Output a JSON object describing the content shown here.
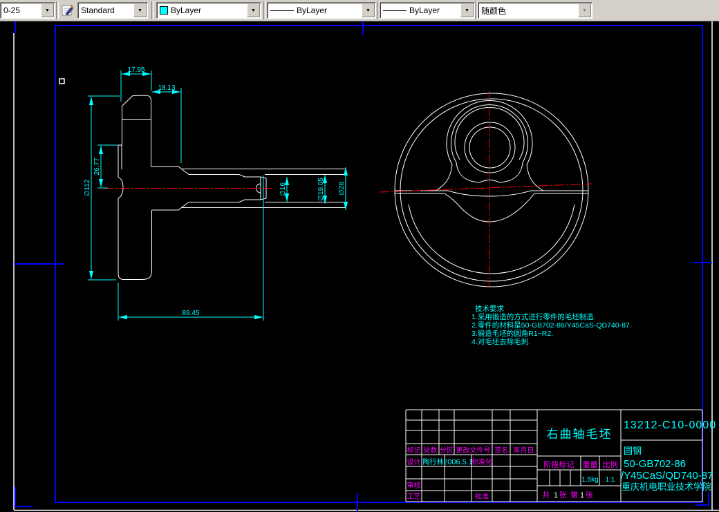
{
  "toolbar": {
    "dim_style_value": "0-25",
    "text_style_value": "Standard",
    "color_value": "ByLayer",
    "linetype_value": "ByLayer",
    "lineweight_value": "ByLayer",
    "plot_style_value": "随颜色",
    "dropdown_glyph": "▼"
  },
  "colors": {
    "cad_cyan": "#00ffff",
    "cad_red": "#ff0000",
    "cad_magenta": "#ff00ff",
    "cad_white": "#ffffff",
    "frame_blue": "#0000ff"
  },
  "dimensions": {
    "d_17_95": "17.95",
    "d_18_13": "18.13",
    "d_26_77": "26.77",
    "d_dia112": "∅112",
    "d_89_45": "89.45",
    "d_dia16": "∅16",
    "d_dia19_05": "∅19.05",
    "d_dia28": "∅28"
  },
  "tech_requirements": {
    "title": "技术要求",
    "line1": "1.采用锻造的方式进行零件的毛坯制造.",
    "line2": "2.零件的材料是50-GB702-86/Y45CaS-QD740-87.",
    "line3": "3.锻造毛坯的圆角R1~R2.",
    "line4": "4.对毛坯去除毛刺."
  },
  "title_block": {
    "part_name": "右曲轴毛坯",
    "drawing_number": "13212-C10-0000",
    "material_line1": "圆钢",
    "material_line2": "50-GB702-86",
    "material_line3": "/Y45CaS/QD740-87",
    "organization": "重庆机电职业技术学院",
    "header_mark": "标记",
    "header_count": "处数",
    "header_zone": "分区",
    "header_change_doc": "更改文件号",
    "header_signature": "签名",
    "header_date": "年月日",
    "design_label": "设计",
    "designer_name": "陶行林",
    "design_date": "2006.5.1",
    "standardization_label": "标准化",
    "review_label": "审核",
    "process_label": "工艺",
    "approve_label": "批准",
    "stage_mark_label": "阶段标记",
    "weight_label": "重量",
    "scale_label": "比例",
    "weight_value": "1.5kg",
    "scale_value": "1:1",
    "sheet_total_prefix": "共",
    "sheet_total_num": "1",
    "sheet_total_suffix": "张",
    "sheet_index_prefix": "第",
    "sheet_index_num": "1",
    "sheet_index_suffix": "张"
  }
}
